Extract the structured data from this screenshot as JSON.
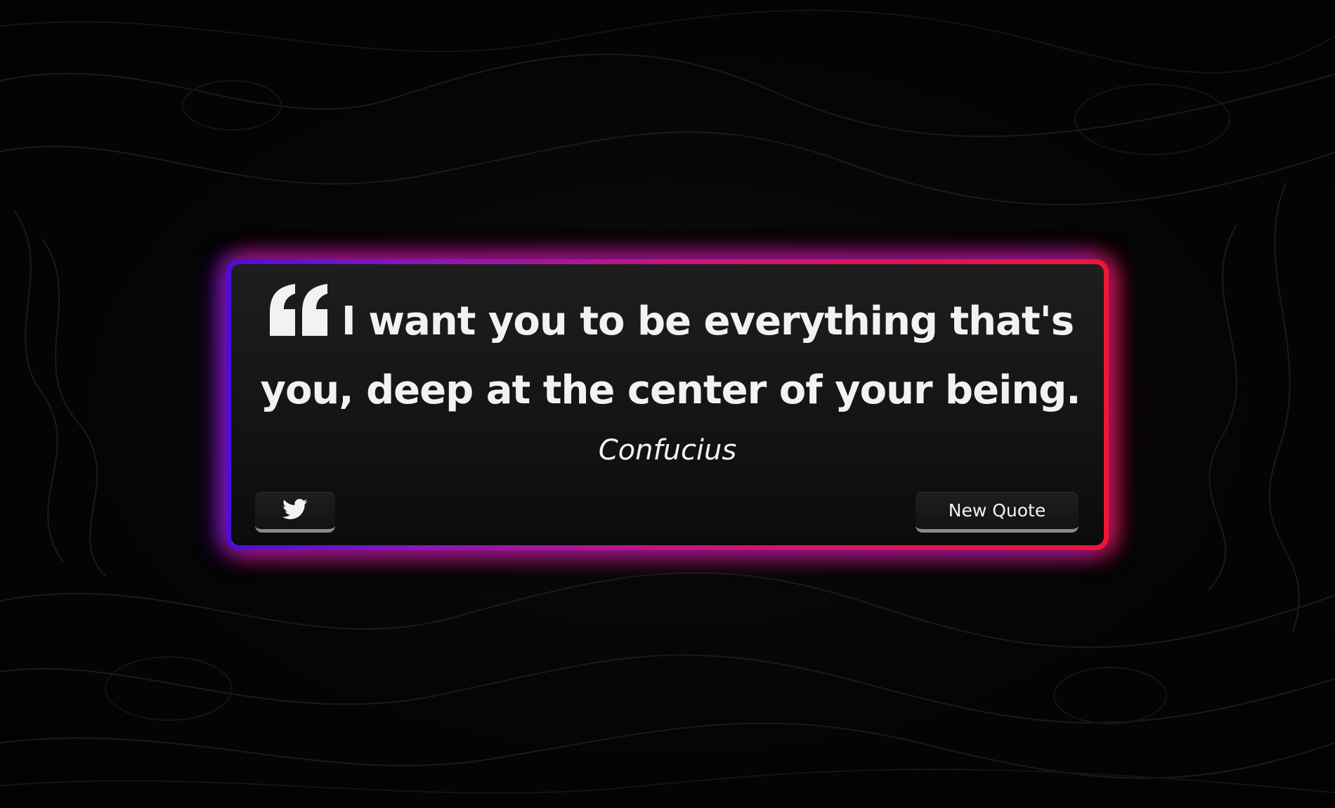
{
  "quote": {
    "text": "I want you to be everything that's you, deep at the center of your being.",
    "author": "Confucius"
  },
  "buttons": {
    "tweet_icon": "twitter-icon",
    "new_quote_label": "New Quote"
  },
  "colors": {
    "background": "#040404",
    "glow_left": "#4c0fd6",
    "glow_mid": "#c4157f",
    "glow_right": "#ee1638",
    "text": "#f2f2f2"
  }
}
